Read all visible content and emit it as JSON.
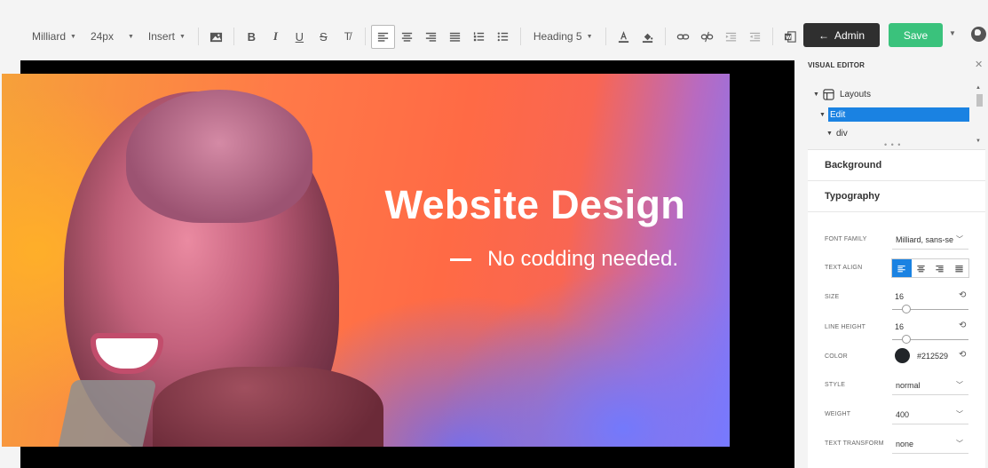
{
  "toolbar": {
    "font_family": "Milliard",
    "font_size": "24px",
    "insert": "Insert",
    "heading": "Heading 5"
  },
  "buttons": {
    "admin": "Admin",
    "save": "Save"
  },
  "hero": {
    "title": "Website Design",
    "subtitle": "No codding needed."
  },
  "panel": {
    "title": "VISUAL EDITOR",
    "tree": [
      {
        "label": "Layouts"
      },
      {
        "label": "Edit"
      },
      {
        "label": "div"
      }
    ],
    "sections": {
      "background": "Background",
      "typography": "Typography"
    },
    "props": {
      "font_family": {
        "label": "FONT FAMILY",
        "value": "Milliard, sans-se"
      },
      "text_align": {
        "label": "TEXT ALIGN",
        "selected": "left"
      },
      "size": {
        "label": "SIZE",
        "value": "16",
        "level": 0.15
      },
      "line_height": {
        "label": "LINE HEIGHT",
        "value": "16",
        "level": 0.15
      },
      "color": {
        "label": "COLOR",
        "value": "#212529"
      },
      "style": {
        "label": "STYLE",
        "value": "normal"
      },
      "weight": {
        "label": "WEIGHT",
        "value": "400"
      },
      "text_transform": {
        "label": "TEXT TRANSFORM",
        "value": "none"
      }
    }
  },
  "colors": {
    "admin_bg": "#2f2f2f",
    "save_bg": "#3ac27c",
    "selection": "#1a82e2"
  }
}
